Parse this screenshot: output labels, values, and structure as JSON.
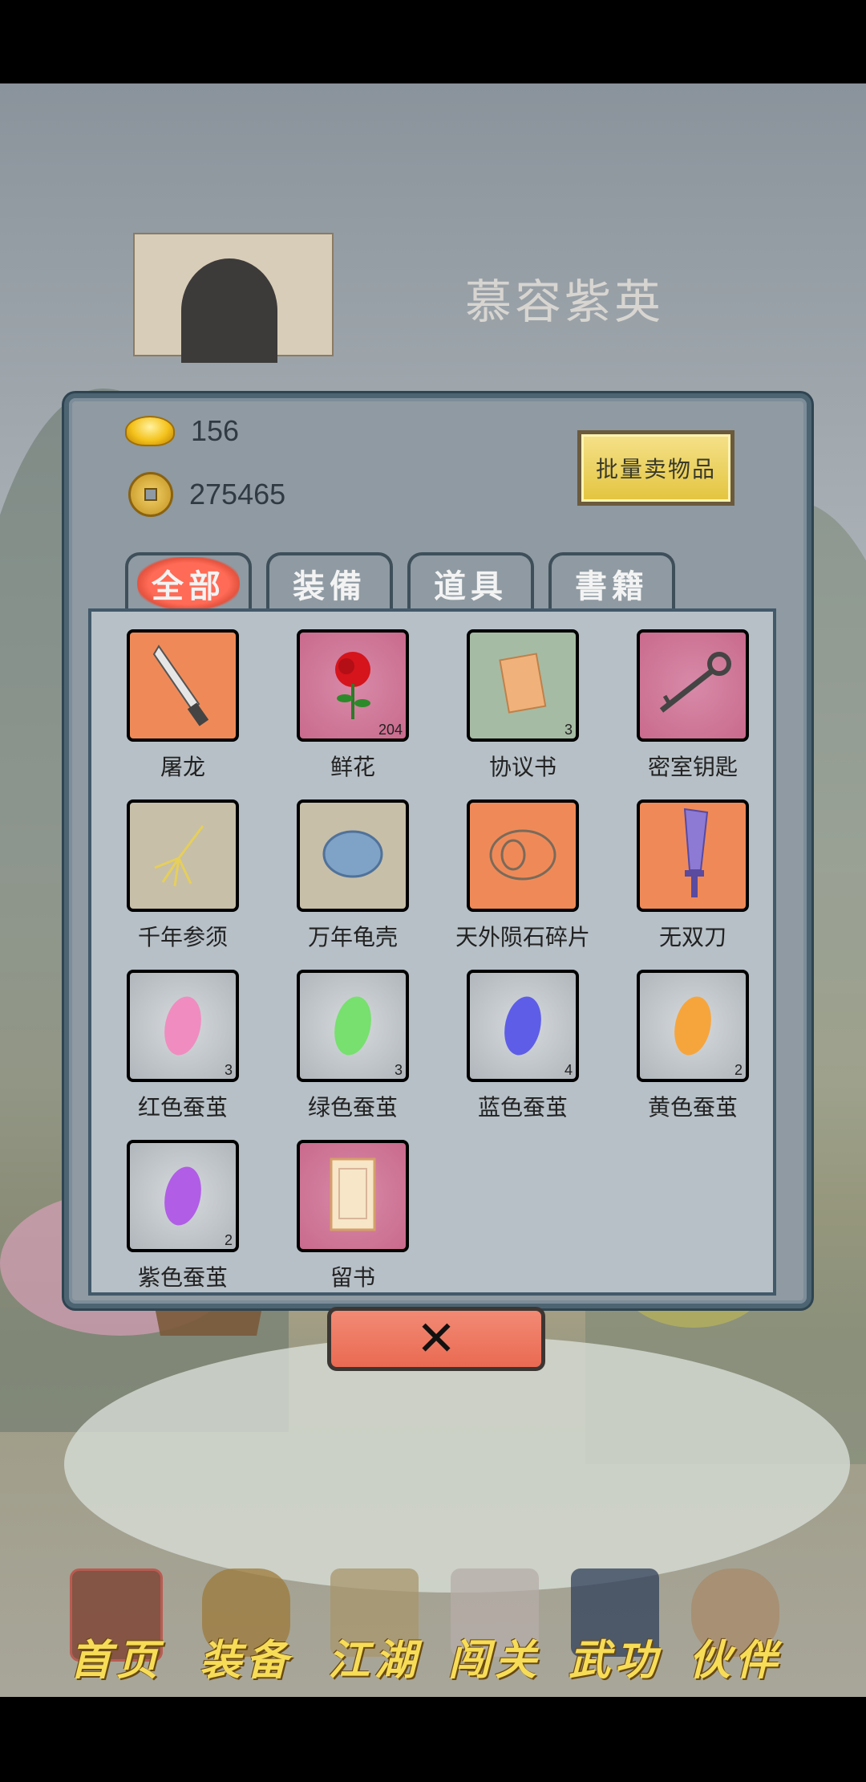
{
  "character": {
    "name": "慕容紫英"
  },
  "currency": {
    "gold": "156",
    "coins": "275465"
  },
  "sell_button": "批量卖物品",
  "tabs": [
    "全部",
    "装備",
    "道具",
    "書籍"
  ],
  "items": [
    {
      "name": "屠龙",
      "count": "",
      "rarity": "red",
      "icon": "broadsword-icon"
    },
    {
      "name": "鲜花",
      "count": "204",
      "rarity": "pink",
      "icon": "rose-icon"
    },
    {
      "name": "协议书",
      "count": "3",
      "rarity": "green",
      "icon": "document-icon"
    },
    {
      "name": "密室钥匙",
      "count": "",
      "rarity": "pink",
      "icon": "key-icon"
    },
    {
      "name": "千年参须",
      "count": "",
      "rarity": "orange",
      "icon": "ginseng-icon"
    },
    {
      "name": "万年龟壳",
      "count": "",
      "rarity": "orange",
      "icon": "turtle-shell-icon"
    },
    {
      "name": "天外陨石碎片",
      "count": "",
      "rarity": "red",
      "icon": "meteorite-icon"
    },
    {
      "name": "无双刀",
      "count": "",
      "rarity": "red",
      "icon": "blade-icon"
    },
    {
      "name": "红色蚕茧",
      "count": "3",
      "rarity": "white",
      "icon": "pink-cocoon-icon",
      "color": "#f08cc0"
    },
    {
      "name": "绿色蚕茧",
      "count": "3",
      "rarity": "white",
      "icon": "green-cocoon-icon",
      "color": "#77e06f"
    },
    {
      "name": "蓝色蚕茧",
      "count": "4",
      "rarity": "white",
      "icon": "blue-cocoon-icon",
      "color": "#5e5de8"
    },
    {
      "name": "黄色蚕茧",
      "count": "2",
      "rarity": "white",
      "icon": "orange-cocoon-icon",
      "color": "#f6a53c"
    },
    {
      "name": "紫色蚕茧",
      "count": "2",
      "rarity": "white",
      "icon": "purple-cocoon-icon",
      "color": "#b15de6"
    },
    {
      "name": "留书",
      "count": "",
      "rarity": "pink",
      "icon": "letter-icon"
    }
  ],
  "close_icon": "close-x-icon",
  "nav": [
    "首页",
    "装备",
    "江湖",
    "闯关",
    "武功",
    "伙伴"
  ]
}
